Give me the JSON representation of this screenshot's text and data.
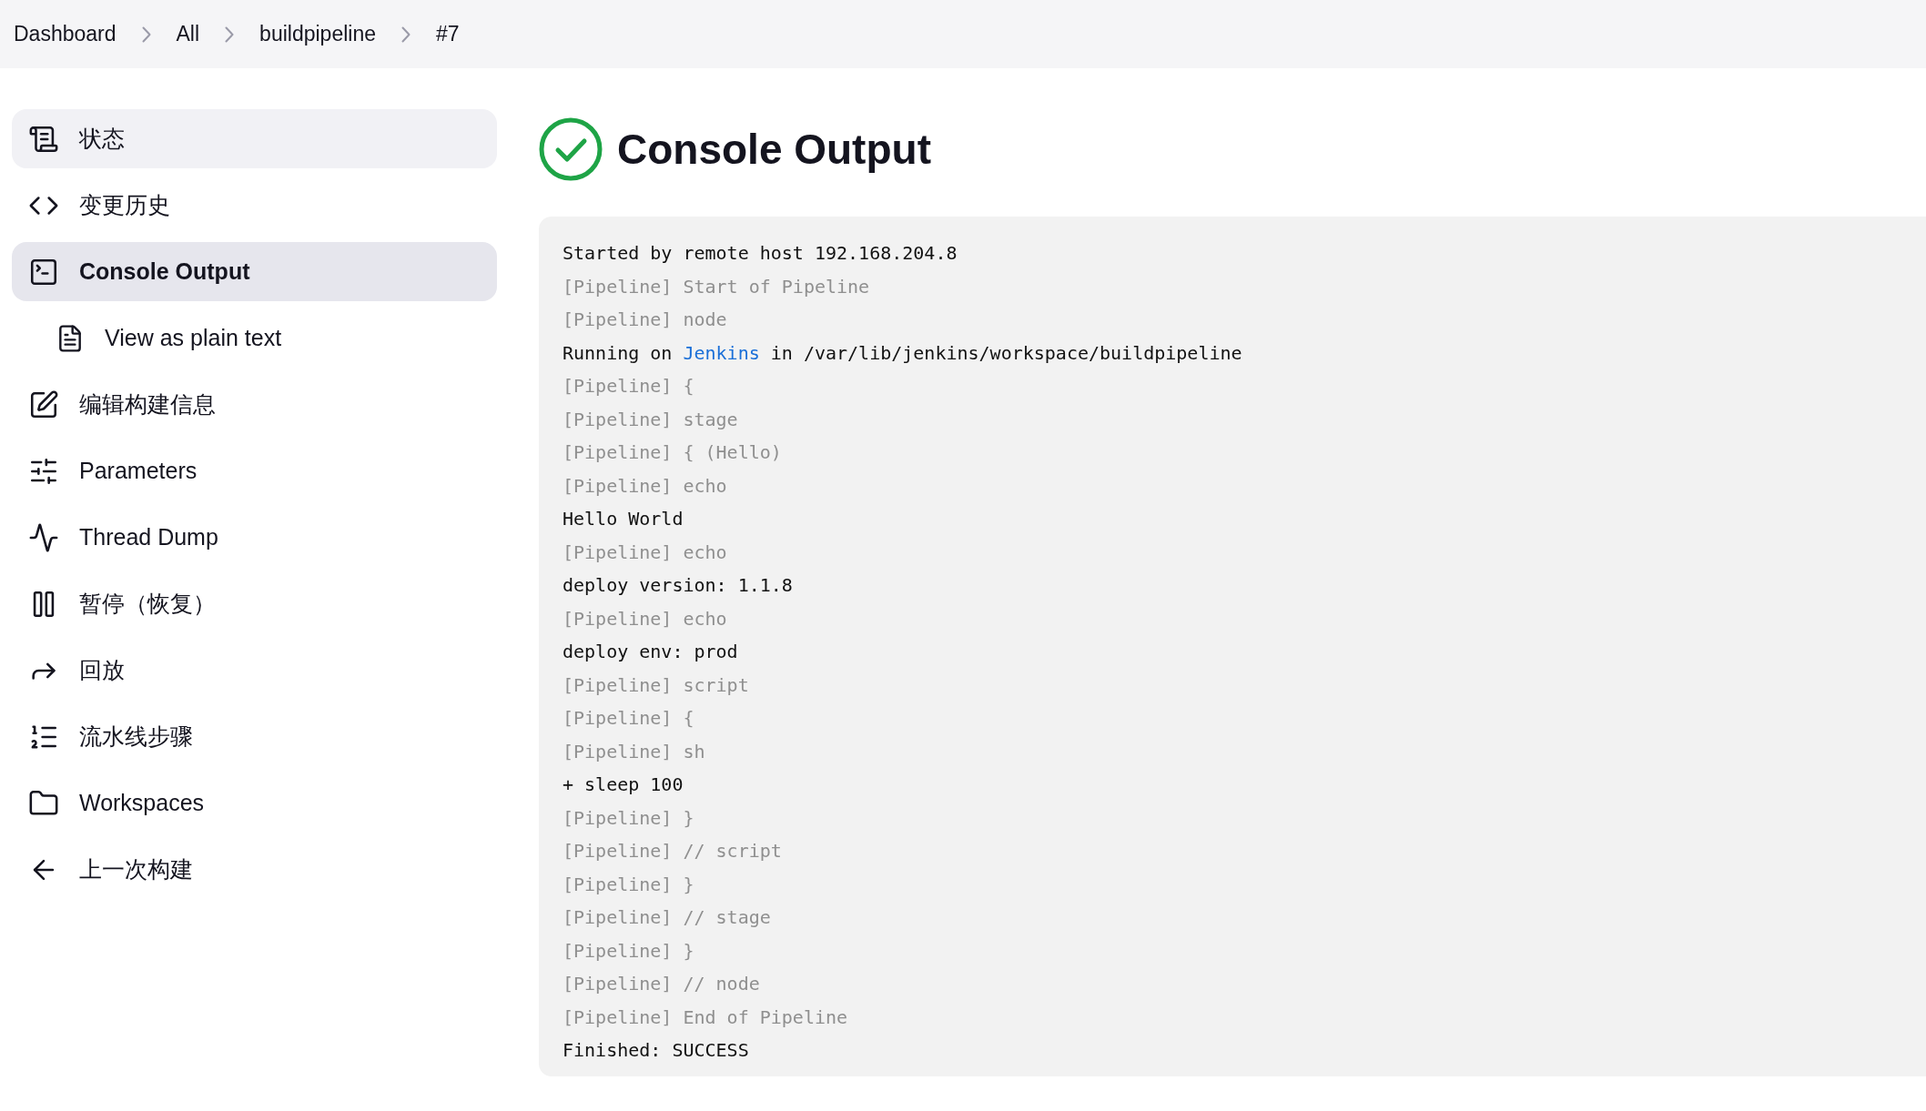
{
  "breadcrumb": [
    "Dashboard",
    "All",
    "buildpipeline",
    "#7"
  ],
  "sidebar": {
    "items": [
      {
        "label": "状态",
        "selected": false,
        "highlighted": true
      },
      {
        "label": "变更历史",
        "selected": false,
        "highlighted": false
      },
      {
        "label": "Console Output",
        "selected": true,
        "highlighted": false,
        "children": [
          {
            "label": "View as plain text",
            "selected": false,
            "highlighted": false
          }
        ]
      },
      {
        "label": "编辑构建信息",
        "selected": false,
        "highlighted": false
      },
      {
        "label": "Parameters",
        "selected": false,
        "highlighted": false
      },
      {
        "label": "Thread Dump",
        "selected": false,
        "highlighted": false
      },
      {
        "label": "暂停（恢复）",
        "selected": false,
        "highlighted": false
      },
      {
        "label": "回放",
        "selected": false,
        "highlighted": false
      },
      {
        "label": "流水线步骤",
        "selected": false,
        "highlighted": false
      },
      {
        "label": "Workspaces",
        "selected": false,
        "highlighted": false
      },
      {
        "label": "上一次构建",
        "selected": false,
        "highlighted": false
      }
    ]
  },
  "page": {
    "title": "Console Output"
  },
  "console": {
    "lines": [
      {
        "kind": "output",
        "text": "Started by remote host 192.168.204.8"
      },
      {
        "kind": "pipeline",
        "text": "[Pipeline] Start of Pipeline"
      },
      {
        "kind": "pipeline",
        "text": "[Pipeline] node"
      },
      {
        "kind": "link",
        "before": "Running on ",
        "link": "Jenkins",
        "after": " in /var/lib/jenkins/workspace/buildpipeline"
      },
      {
        "kind": "pipeline",
        "text": "[Pipeline] {"
      },
      {
        "kind": "pipeline",
        "text": "[Pipeline] stage"
      },
      {
        "kind": "pipeline",
        "text": "[Pipeline] { (Hello)"
      },
      {
        "kind": "pipeline",
        "text": "[Pipeline] echo"
      },
      {
        "kind": "output",
        "text": "Hello World"
      },
      {
        "kind": "pipeline",
        "text": "[Pipeline] echo"
      },
      {
        "kind": "output",
        "text": "deploy version: 1.1.8"
      },
      {
        "kind": "pipeline",
        "text": "[Pipeline] echo"
      },
      {
        "kind": "output",
        "text": "deploy env: prod"
      },
      {
        "kind": "pipeline",
        "text": "[Pipeline] script"
      },
      {
        "kind": "pipeline",
        "text": "[Pipeline] {"
      },
      {
        "kind": "pipeline",
        "text": "[Pipeline] sh"
      },
      {
        "kind": "output",
        "text": "+ sleep 100"
      },
      {
        "kind": "pipeline",
        "text": "[Pipeline] }"
      },
      {
        "kind": "pipeline",
        "text": "[Pipeline] // script"
      },
      {
        "kind": "pipeline",
        "text": "[Pipeline] }"
      },
      {
        "kind": "pipeline",
        "text": "[Pipeline] // stage"
      },
      {
        "kind": "pipeline",
        "text": "[Pipeline] }"
      },
      {
        "kind": "pipeline",
        "text": "[Pipeline] // node"
      },
      {
        "kind": "pipeline",
        "text": "[Pipeline] End of Pipeline"
      },
      {
        "kind": "output",
        "text": "Finished: SUCCESS"
      }
    ]
  }
}
